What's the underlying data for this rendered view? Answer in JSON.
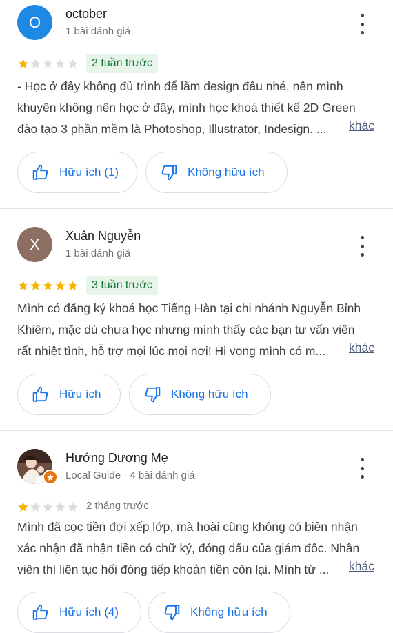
{
  "reviews": [
    {
      "avatar_letter": "O",
      "avatar_color": "#1e88e5",
      "name": "october",
      "meta": "1 bài đánh giá",
      "rating": 1,
      "time": "2 tuần trước",
      "text_lines": [
        "- Học ở đây không đủ trình để làm design đâu nhé, nên mình",
        "khuyên không nên học ở đây, mình học khoá thiết kế 2D Green",
        "đào tạo 3 phần mềm là Photoshop, Illustrator, Indesign. ..."
      ],
      "more": "khác",
      "helpful": "Hữu ích (1)",
      "not_helpful": "Không hữu ích"
    },
    {
      "avatar_letter": "X",
      "avatar_color": "#8d6e63",
      "name": "Xuân Nguyễn",
      "meta": "1 bài đánh giá",
      "rating": 5,
      "time": "3 tuần trước",
      "text_lines": [
        "Mình có đăng ký khoá học Tiếng Hàn tại chi nhánh Nguyễn Bỉnh",
        "Khiêm, mặc dù chưa học nhưng mình thấy các bạn tư vấn viên",
        "rất nhiệt tình, hỗ trợ mọi lúc mọi nơi! Hi vọng mình có m..."
      ],
      "more": "khác",
      "helpful": "Hữu ích",
      "not_helpful": "Không hữu ích"
    },
    {
      "name": "Hướng Dương Mẹ",
      "meta": "Local Guide · 4 bài đánh giá",
      "rating": 1,
      "time": "2 tháng trước",
      "text_lines": [
        "Mình đã cọc tiền đợi xếp lớp, mà hoài cũng không có biên nhận",
        "xác nhận đã nhận tiền có chữ ký, đóng dấu của giám đốc. Nhân",
        "viên thì liên tục hối đóng tiếp khoản tiền còn lại. Mình từ ..."
      ],
      "more": "khác",
      "helpful": "Hữu ích (4)",
      "not_helpful": "Không hữu ích"
    }
  ],
  "colors": {
    "star_filled": "#f4b400",
    "star_empty": "#dadce0",
    "accent": "#1a73e8",
    "badge_bg": "#e6f4ea",
    "badge_text": "#137333"
  }
}
